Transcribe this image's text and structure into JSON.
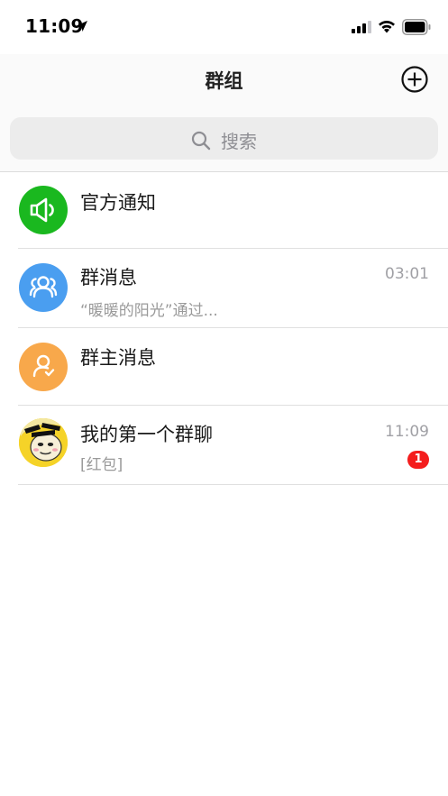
{
  "status_bar": {
    "time": "11:09"
  },
  "nav": {
    "title": "群组"
  },
  "search": {
    "placeholder": "搜索"
  },
  "groups": [
    {
      "name": "官方通知",
      "preview": "",
      "time": "",
      "badge": "",
      "avatar_icon": "speaker-icon",
      "avatar_color": "#1ab81f"
    },
    {
      "name": "群消息",
      "preview": "“暖暖的阳光”通过...",
      "time": "03:01",
      "badge": "",
      "avatar_icon": "group-people-icon",
      "avatar_color": "#4a9ef0"
    },
    {
      "name": "群主消息",
      "preview": "",
      "time": "",
      "badge": "",
      "avatar_icon": "user-check-icon",
      "avatar_color": "#f8a84b"
    },
    {
      "name": "我的第一个群聊",
      "preview": "[红包]",
      "time": "11:09",
      "badge": "1",
      "avatar_icon": "meme-avatar",
      "avatar_color": "#f5d328"
    }
  ],
  "colors": {
    "accent_green": "#1ab81f",
    "accent_blue": "#4a9ef0",
    "accent_orange": "#f8a84b",
    "badge_red": "#f41d1d"
  }
}
